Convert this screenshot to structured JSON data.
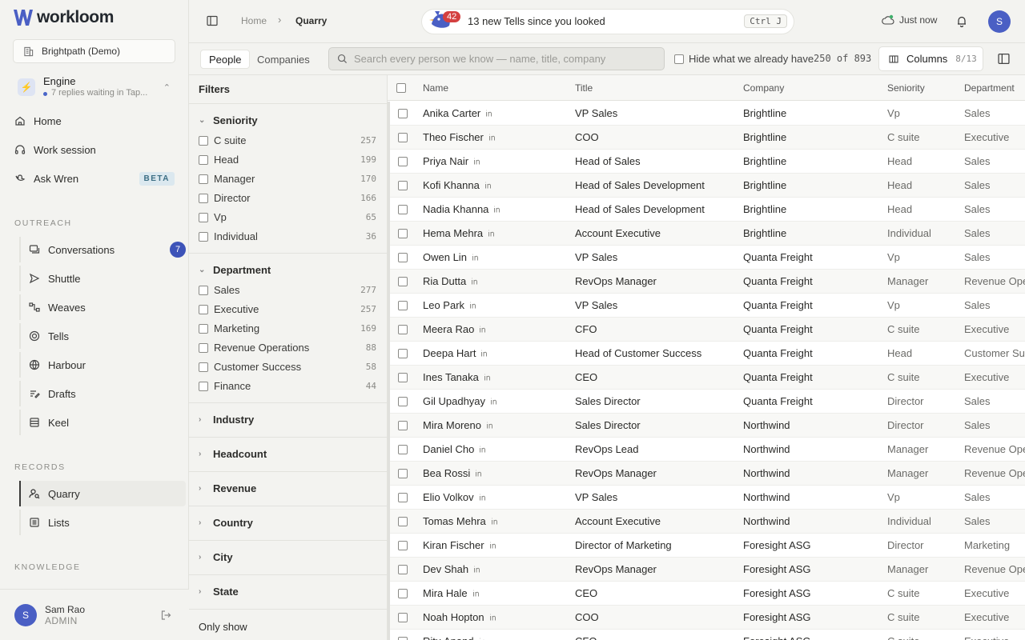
{
  "brand": {
    "name": "workloom"
  },
  "workspace": {
    "name": "Brightpath (Demo)"
  },
  "engine": {
    "title": "Engine",
    "subtitle": "7 replies waiting in Tap..."
  },
  "nav": {
    "home": "Home",
    "work_session": "Work session",
    "ask_wren": "Ask Wren",
    "beta_badge": "BETA"
  },
  "sections": {
    "outreach": "OUTREACH",
    "records": "RECORDS",
    "knowledge": "KNOWLEDGE"
  },
  "outreach_items": [
    {
      "label": "Conversations",
      "badge": "7",
      "icon": "conversations-icon"
    },
    {
      "label": "Shuttle",
      "icon": "send-icon"
    },
    {
      "label": "Weaves",
      "icon": "workflow-icon"
    },
    {
      "label": "Tells",
      "icon": "target-icon"
    },
    {
      "label": "Harbour",
      "icon": "globe-icon"
    },
    {
      "label": "Drafts",
      "icon": "drafts-icon"
    },
    {
      "label": "Keel",
      "icon": "database-icon"
    }
  ],
  "records_items": [
    {
      "label": "Quarry",
      "active": true,
      "icon": "people-search-icon"
    },
    {
      "label": "Lists",
      "icon": "list-icon"
    }
  ],
  "user": {
    "initial": "S",
    "name": "Sam Rao",
    "role": "ADMIN"
  },
  "topbar": {
    "breadcrumb_home": "Home",
    "breadcrumb_current": "Quarry",
    "tells_count": "42",
    "tells_text": "13 new Tells since you looked",
    "shortcut": "Ctrl J",
    "sync_status": "Just now",
    "avatar_initial": "S"
  },
  "toolbar": {
    "tab_people": "People",
    "tab_companies": "Companies",
    "search_placeholder": "Search every person we know — name, title, company",
    "hide_known": "Hide what we already have",
    "result_count": "250 of 893",
    "columns_label": "Columns",
    "columns_count": "8/13"
  },
  "filters": {
    "title": "Filters",
    "seniority": {
      "title": "Seniority",
      "options": [
        {
          "label": "C suite",
          "count": "257"
        },
        {
          "label": "Head",
          "count": "199"
        },
        {
          "label": "Manager",
          "count": "170"
        },
        {
          "label": "Director",
          "count": "166"
        },
        {
          "label": "Vp",
          "count": "65"
        },
        {
          "label": "Individual",
          "count": "36"
        }
      ]
    },
    "department": {
      "title": "Department",
      "options": [
        {
          "label": "Sales",
          "count": "277"
        },
        {
          "label": "Executive",
          "count": "257"
        },
        {
          "label": "Marketing",
          "count": "169"
        },
        {
          "label": "Revenue Operations",
          "count": "88"
        },
        {
          "label": "Customer Success",
          "count": "58"
        },
        {
          "label": "Finance",
          "count": "44"
        }
      ]
    },
    "collapsed": [
      "Industry",
      "Headcount",
      "Revenue",
      "Country",
      "City",
      "State"
    ],
    "only_show": "Only show"
  },
  "table": {
    "headers": {
      "name": "Name",
      "title": "Title",
      "company": "Company",
      "seniority": "Seniority",
      "department": "Department"
    },
    "rows": [
      {
        "name": "Anika Carter",
        "title": "VP Sales",
        "company": "Brightline",
        "seniority": "Vp",
        "department": "Sales"
      },
      {
        "name": "Theo Fischer",
        "title": "COO",
        "company": "Brightline",
        "seniority": "C suite",
        "department": "Executive"
      },
      {
        "name": "Priya Nair",
        "title": "Head of Sales",
        "company": "Brightline",
        "seniority": "Head",
        "department": "Sales"
      },
      {
        "name": "Kofi Khanna",
        "title": "Head of Sales Development",
        "company": "Brightline",
        "seniority": "Head",
        "department": "Sales"
      },
      {
        "name": "Nadia Khanna",
        "title": "Head of Sales Development",
        "company": "Brightline",
        "seniority": "Head",
        "department": "Sales"
      },
      {
        "name": "Hema Mehra",
        "title": "Account Executive",
        "company": "Brightline",
        "seniority": "Individual",
        "department": "Sales"
      },
      {
        "name": "Owen Lin",
        "title": "VP Sales",
        "company": "Quanta Freight",
        "seniority": "Vp",
        "department": "Sales"
      },
      {
        "name": "Ria Dutta",
        "title": "RevOps Manager",
        "company": "Quanta Freight",
        "seniority": "Manager",
        "department": "Revenue Ope"
      },
      {
        "name": "Leo Park",
        "title": "VP Sales",
        "company": "Quanta Freight",
        "seniority": "Vp",
        "department": "Sales"
      },
      {
        "name": "Meera Rao",
        "title": "CFO",
        "company": "Quanta Freight",
        "seniority": "C suite",
        "department": "Executive"
      },
      {
        "name": "Deepa Hart",
        "title": "Head of Customer Success",
        "company": "Quanta Freight",
        "seniority": "Head",
        "department": "Customer Suc"
      },
      {
        "name": "Ines Tanaka",
        "title": "CEO",
        "company": "Quanta Freight",
        "seniority": "C suite",
        "department": "Executive"
      },
      {
        "name": "Gil Upadhyay",
        "title": "Sales Director",
        "company": "Quanta Freight",
        "seniority": "Director",
        "department": "Sales"
      },
      {
        "name": "Mira Moreno",
        "title": "Sales Director",
        "company": "Northwind",
        "seniority": "Director",
        "department": "Sales"
      },
      {
        "name": "Daniel Cho",
        "title": "RevOps Lead",
        "company": "Northwind",
        "seniority": "Manager",
        "department": "Revenue Ope"
      },
      {
        "name": "Bea Rossi",
        "title": "RevOps Manager",
        "company": "Northwind",
        "seniority": "Manager",
        "department": "Revenue Ope"
      },
      {
        "name": "Elio Volkov",
        "title": "VP Sales",
        "company": "Northwind",
        "seniority": "Vp",
        "department": "Sales"
      },
      {
        "name": "Tomas Mehra",
        "title": "Account Executive",
        "company": "Northwind",
        "seniority": "Individual",
        "department": "Sales"
      },
      {
        "name": "Kiran Fischer",
        "title": "Director of Marketing",
        "company": "Foresight ASG",
        "seniority": "Director",
        "department": "Marketing"
      },
      {
        "name": "Dev Shah",
        "title": "RevOps Manager",
        "company": "Foresight ASG",
        "seniority": "Manager",
        "department": "Revenue Ope"
      },
      {
        "name": "Mira Hale",
        "title": "CEO",
        "company": "Foresight ASG",
        "seniority": "C suite",
        "department": "Executive"
      },
      {
        "name": "Noah Hopton",
        "title": "COO",
        "company": "Foresight ASG",
        "seniority": "C suite",
        "department": "Executive"
      },
      {
        "name": "Ritu Anand",
        "title": "CFO",
        "company": "Foresight ASG",
        "seniority": "C suite",
        "department": "Executive"
      }
    ]
  }
}
